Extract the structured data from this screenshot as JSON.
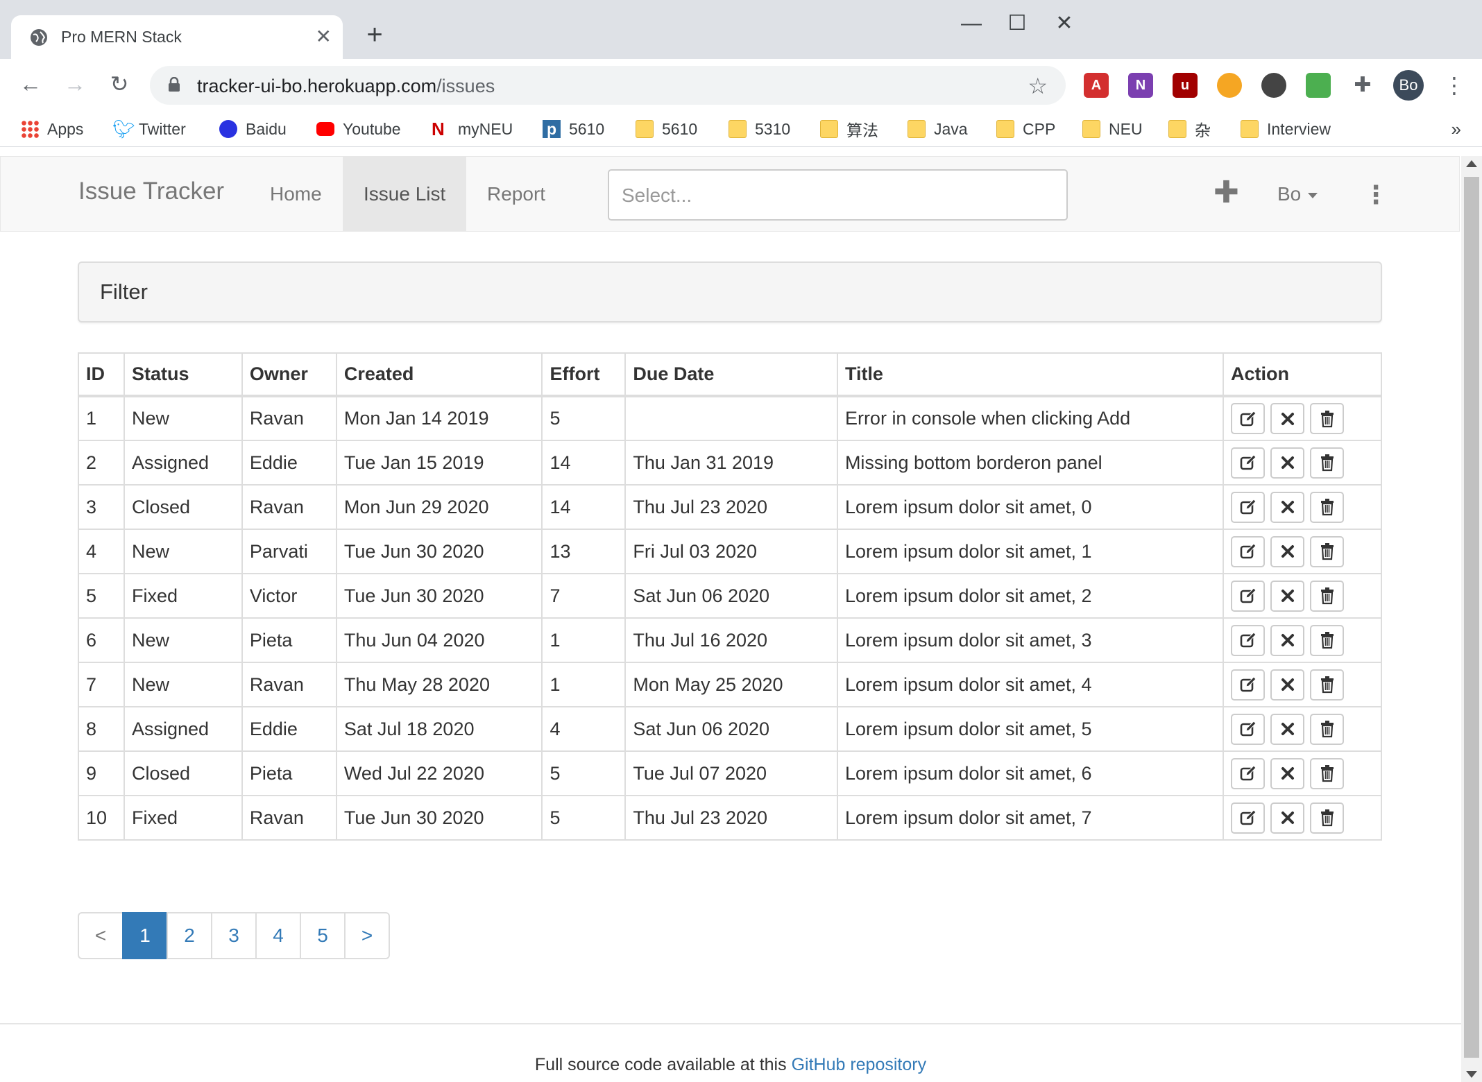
{
  "browser": {
    "tab_title": "Pro MERN Stack",
    "url_host": "tracker-ui-bo.herokuapp.com",
    "url_path": "/issues",
    "profile_initials": "Bo",
    "bookmarks": [
      {
        "label": "Apps",
        "icon": "apps-grid-icon"
      },
      {
        "label": "Twitter",
        "icon": "twitter-icon"
      },
      {
        "label": "Baidu",
        "icon": "baidu-icon"
      },
      {
        "label": "Youtube",
        "icon": "youtube-icon"
      },
      {
        "label": "myNEU",
        "icon": "myneu-icon"
      },
      {
        "label": "5610",
        "icon": "p-icon"
      },
      {
        "label": "5610",
        "icon": "folder-icon"
      },
      {
        "label": "5310",
        "icon": "folder-icon"
      },
      {
        "label": "算法",
        "icon": "folder-icon"
      },
      {
        "label": "Java",
        "icon": "folder-icon"
      },
      {
        "label": "CPP",
        "icon": "folder-icon"
      },
      {
        "label": "NEU",
        "icon": "folder-icon"
      },
      {
        "label": "杂",
        "icon": "folder-icon"
      },
      {
        "label": "Interview",
        "icon": "folder-icon"
      }
    ],
    "bookmarks_more": "»"
  },
  "navbar": {
    "brand": "Issue Tracker",
    "items": [
      "Home",
      "Issue List",
      "Report"
    ],
    "active_item": "Issue List",
    "search_placeholder": "Select...",
    "user": "Bo"
  },
  "filter": {
    "title": "Filter"
  },
  "table": {
    "headers": [
      "ID",
      "Status",
      "Owner",
      "Created",
      "Effort",
      "Due Date",
      "Title",
      "Action"
    ],
    "rows": [
      [
        "1",
        "New",
        "Ravan",
        "Mon Jan 14 2019",
        "5",
        "",
        "Error in console when clicking Add"
      ],
      [
        "2",
        "Assigned",
        "Eddie",
        "Tue Jan 15 2019",
        "14",
        "Thu Jan 31 2019",
        "Missing bottom borderon panel"
      ],
      [
        "3",
        "Closed",
        "Ravan",
        "Mon Jun 29 2020",
        "14",
        "Thu Jul 23 2020",
        "Lorem ipsum dolor sit amet, 0"
      ],
      [
        "4",
        "New",
        "Parvati",
        "Tue Jun 30 2020",
        "13",
        "Fri Jul 03 2020",
        "Lorem ipsum dolor sit amet, 1"
      ],
      [
        "5",
        "Fixed",
        "Victor",
        "Tue Jun 30 2020",
        "7",
        "Sat Jun 06 2020",
        "Lorem ipsum dolor sit amet, 2"
      ],
      [
        "6",
        "New",
        "Pieta",
        "Thu Jun 04 2020",
        "1",
        "Thu Jul 16 2020",
        "Lorem ipsum dolor sit amet, 3"
      ],
      [
        "7",
        "New",
        "Ravan",
        "Thu May 28 2020",
        "1",
        "Mon May 25 2020",
        "Lorem ipsum dolor sit amet, 4"
      ],
      [
        "8",
        "Assigned",
        "Eddie",
        "Sat Jul 18 2020",
        "4",
        "Sat Jun 06 2020",
        "Lorem ipsum dolor sit amet, 5"
      ],
      [
        "9",
        "Closed",
        "Pieta",
        "Wed Jul 22 2020",
        "5",
        "Tue Jul 07 2020",
        "Lorem ipsum dolor sit amet, 6"
      ],
      [
        "10",
        "Fixed",
        "Ravan",
        "Tue Jun 30 2020",
        "5",
        "Thu Jul 23 2020",
        "Lorem ipsum dolor sit amet, 7"
      ]
    ],
    "actions": [
      "edit-icon",
      "close-icon",
      "trash-icon"
    ]
  },
  "pagination": {
    "prev": "<",
    "pages": [
      "1",
      "2",
      "3",
      "4",
      "5"
    ],
    "active": "1",
    "next": ">"
  },
  "footer": {
    "text": "Full source code available at this",
    "link": "GitHub repository"
  },
  "colors": {
    "primary": "#337ab7",
    "navbar_bg": "#f8f8f8",
    "active_nav_bg": "#e7e7e7"
  }
}
